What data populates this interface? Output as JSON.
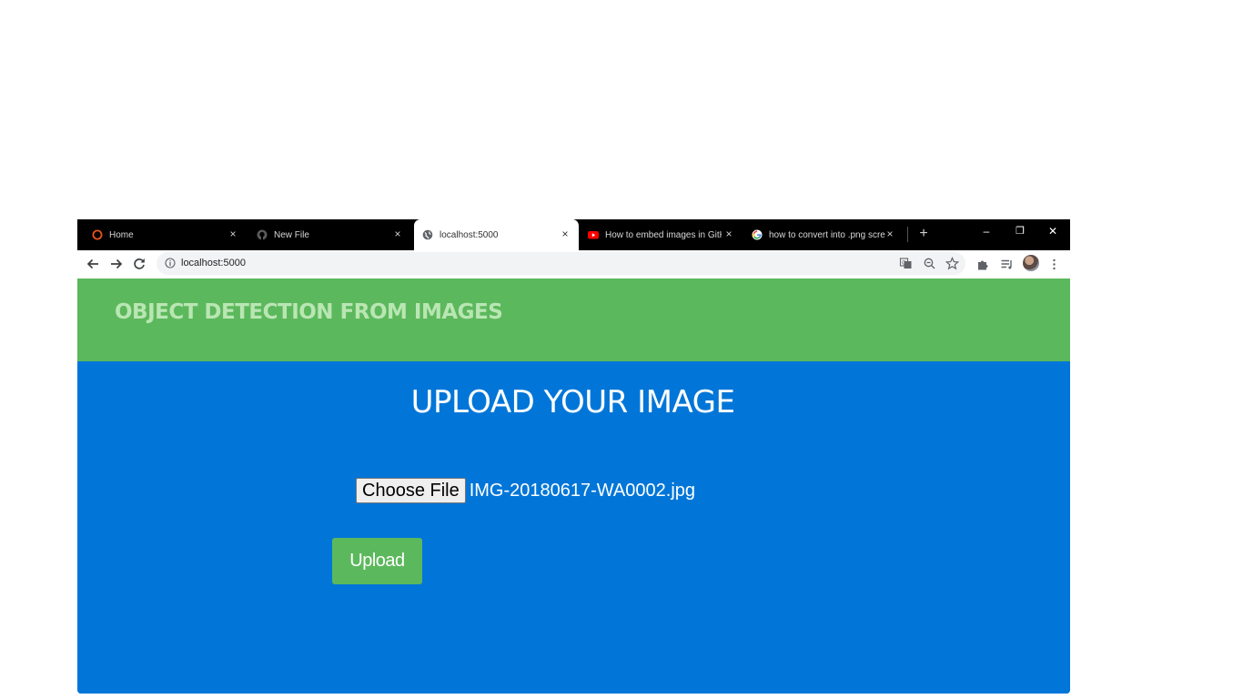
{
  "browser": {
    "tabs": [
      {
        "title": "Home",
        "icon": "opera-icon",
        "active": false
      },
      {
        "title": "New File",
        "icon": "github-icon",
        "active": false
      },
      {
        "title": "localhost:5000",
        "icon": "globe-icon",
        "active": true
      },
      {
        "title": "How to embed images in GitH",
        "icon": "youtube-icon",
        "active": false
      },
      {
        "title": "how to convert into .png scre",
        "icon": "google-icon",
        "active": false
      }
    ],
    "tab_close_glyph": "×",
    "new_tab_glyph": "+",
    "window_controls": {
      "minimize": "–",
      "restore": "❐",
      "close": "✕"
    },
    "address_bar": {
      "url": "localhost:5000"
    }
  },
  "page": {
    "header_title": "OBJECT DETECTION FROM IMAGES",
    "upload_title": "UPLOAD YOUR IMAGE",
    "file_input": {
      "button_label": "Choose File",
      "selected_file": "IMG-20180617-WA0002.jpg"
    },
    "upload_button_label": "Upload"
  },
  "colors": {
    "header_bg": "#5cb85c",
    "header_text": "#b9e6b3",
    "page_bg": "#0276d8",
    "upload_button_bg": "#5cb85c",
    "tabstrip_bg": "#000000"
  }
}
